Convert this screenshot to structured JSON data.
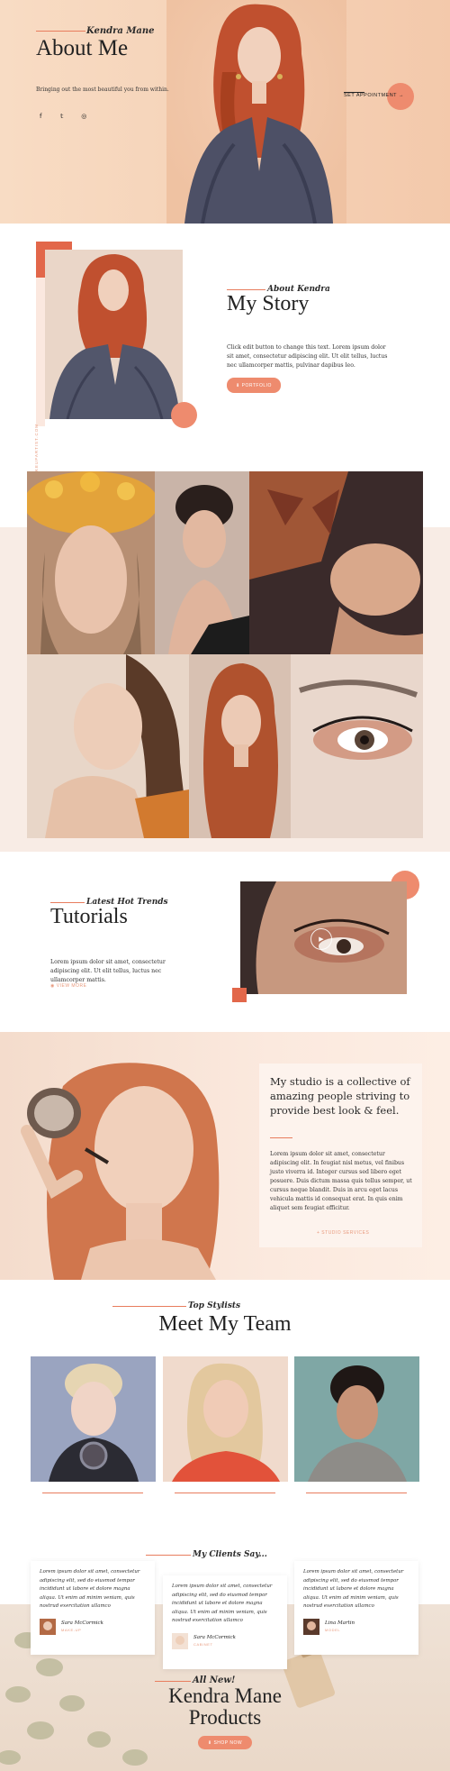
{
  "hero": {
    "script_title": "Kendra Mane",
    "title": "About Me",
    "tagline": "Bringing out the most beautiful you from within.",
    "social": [
      {
        "icon": "facebook-icon",
        "glyph": "f"
      },
      {
        "icon": "twitter-icon",
        "glyph": "𝕥"
      },
      {
        "icon": "instagram-icon",
        "glyph": "◎"
      }
    ],
    "cta_label": "SET APPOINTMENT",
    "cta_arrow": "→"
  },
  "story": {
    "script_title": "About Kendra",
    "title": "My Story",
    "body": "Click edit button to change this text. Lorem ipsum dolor sit amet, consectetur adipiscing elit. Ut elit tellus, luctus nec ullamcorper mattis, pulvinar dapibus leo.",
    "button_label": "⬇ PORTFOLIO",
    "vertical_text": "KENDRA@MAKEUPARTIST.COM"
  },
  "tutorials": {
    "script_title": "Latest Hot Trends",
    "title": "Tutorials",
    "body": "Lorem ipsum dolor sit amet, consectetur adipiscing elit. Ut elit tellus, luctus nec ullamcorper mattis.",
    "link_label": "VIEW MORE",
    "play_glyph": "▶"
  },
  "studio": {
    "heading": "My studio is a collective of amazing people striving to provide best look & feel.",
    "body": "Lorem ipsum dolor sit amet, consectetur adipiscing elit. In feugiat nisl metus, vel finibus justo viverra id. Integer cursus sed libero eget posuere. Duis dictum massa quis tellus semper, ut cursus neque blandit. Duis in arcu eget lacus vehicula mattis id consequat erat. In quis enim aliquet sem feugiat efficitur.",
    "link_label": "+ STUDIO SERVICES"
  },
  "team": {
    "script_title": "Top Stylists",
    "title": "Meet My Team"
  },
  "clients": {
    "script_title": "My Clients Say...",
    "testimonials": [
      {
        "quote": "Lorem ipsum dolor sit amet, consectetur adipiscing elit, sed do eiusmod tempor incididunt ut labore et dolore magna aliqua. Ut enim ad minim veniam, quis nostrud exercitation ullamco",
        "name": "Sara McCormick",
        "role": "MAKE-UP"
      },
      {
        "quote": "Lorem ipsum dolor sit amet, consectetur adipiscing elit, sed do eiusmod tempor incididunt ut labore et dolore magna aliqua. Ut enim ad minim veniam, quis nostrud exercitation ullamco",
        "name": "Sara McCormick",
        "role": "CABINET"
      },
      {
        "quote": "Lorem ipsum dolor sit amet, consectetur adipiscing elit, sed do eiusmod tempor incididunt ut labore et dolore magna aliqua. Ut enim ad minim veniam, quis nostrud exercitation ullamco",
        "name": "Lina Martin",
        "role": "MODEL"
      }
    ]
  },
  "products": {
    "script_title": "All New!",
    "title_line1": "Kendra Mane",
    "title_line2": "Products",
    "button_label": "⬇ SHOP NOW"
  },
  "colors": {
    "accent": "#ee8b6e",
    "accent_dark": "#e2674a",
    "hero_bg": "#f6d4b9"
  }
}
